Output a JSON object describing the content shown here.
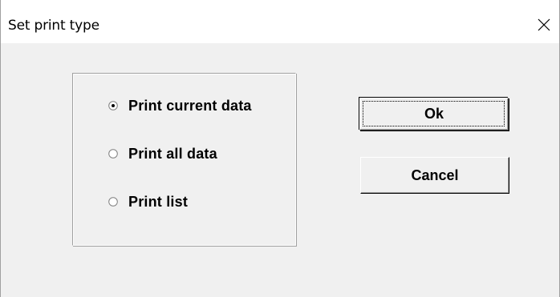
{
  "window": {
    "title": "Set print type"
  },
  "options": {
    "group_label": "",
    "items": [
      {
        "label": "Print current data",
        "selected": true
      },
      {
        "label": "Print all data",
        "selected": false
      },
      {
        "label": "Print list",
        "selected": false
      }
    ]
  },
  "buttons": {
    "ok_label": "Ok",
    "cancel_label": "Cancel"
  },
  "icons": {
    "close": "close-icon",
    "radio_checked": "radio-checked-icon",
    "radio_unchecked": "radio-unchecked-icon"
  }
}
